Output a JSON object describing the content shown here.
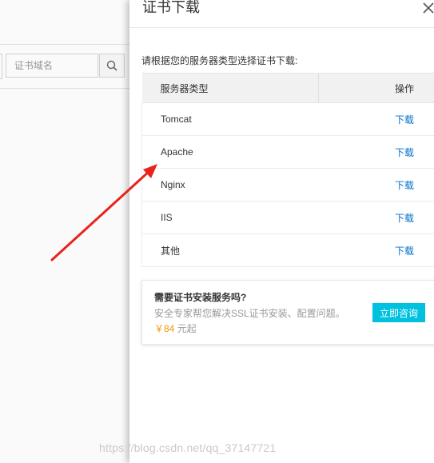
{
  "background": {
    "search": {
      "placeholder": "证书域名"
    }
  },
  "drawer": {
    "title": "证书下载",
    "intro": "请根据您的服务器类型选择证书下载:",
    "table": {
      "headers": {
        "type": "服务器类型",
        "action": "操作"
      },
      "rows": [
        {
          "type": "Tomcat",
          "action": "下载"
        },
        {
          "type": "Apache",
          "action": "下载"
        },
        {
          "type": "Nginx",
          "action": "下载"
        },
        {
          "type": "IIS",
          "action": "下载"
        },
        {
          "type": "其他",
          "action": "下载"
        }
      ]
    },
    "promo": {
      "title": "需要证书安装服务吗?",
      "desc": "安全专家帮您解决SSL证书安装、配置问题。",
      "price": "￥84",
      "price_suffix": "元起",
      "button": "立即咨询"
    }
  },
  "watermark": "https://blog.csdn.net/qq_37147721",
  "colors": {
    "link": "#0070cc",
    "price": "#f39800",
    "button": "#00c1de",
    "arrow": "#e8231d"
  },
  "icons": {
    "search": "search-icon",
    "close": "close-icon",
    "arrow": "annotation-arrow"
  }
}
